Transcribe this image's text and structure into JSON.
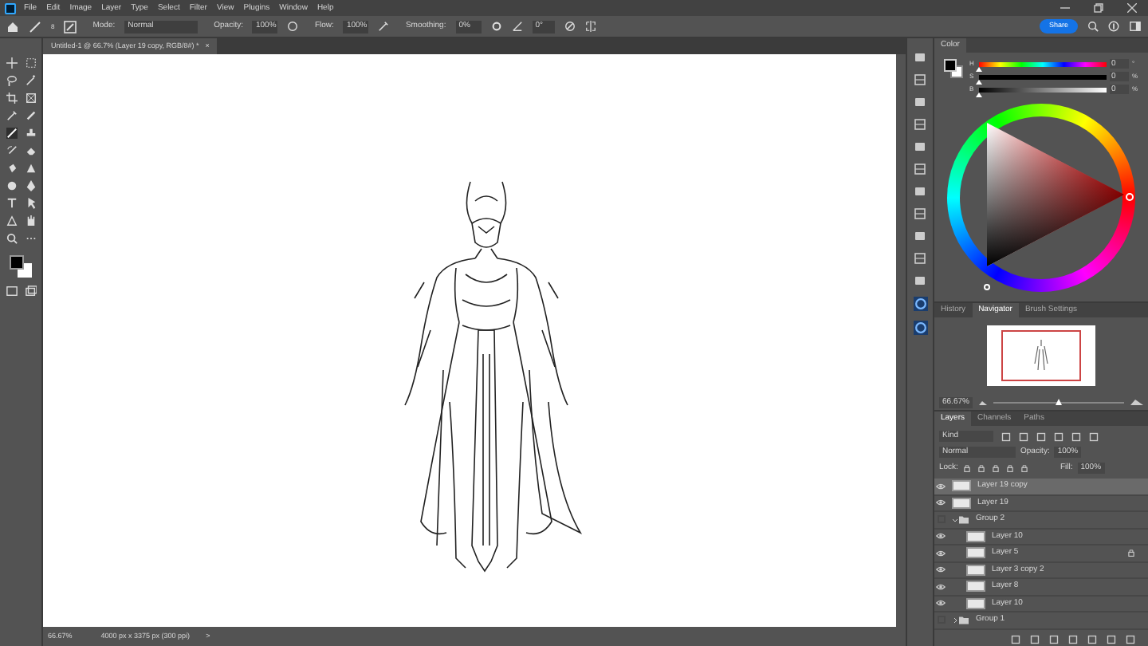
{
  "menu": [
    "File",
    "Edit",
    "Image",
    "Layer",
    "Type",
    "Select",
    "Filter",
    "View",
    "Plugins",
    "Window",
    "Help"
  ],
  "options_bar": {
    "brush_size": "8",
    "mode_label": "Mode:",
    "mode": "Normal",
    "opacity_label": "Opacity:",
    "opacity": "100%",
    "flow_label": "Flow:",
    "flow": "100%",
    "smoothing_label": "Smoothing:",
    "smoothing": "0%",
    "angle": "0°"
  },
  "share_button": "Share",
  "document_tab": {
    "title": "Untitled-1 @ 66.7% (Layer 19 copy, RGB/8#) *",
    "close": "×"
  },
  "color_panel": {
    "tab": "Color",
    "sliders": [
      {
        "label": "H",
        "value": "0",
        "unit": "°",
        "level": 0
      },
      {
        "label": "S",
        "value": "0",
        "unit": "%",
        "level": 0
      },
      {
        "label": "B",
        "value": "0",
        "unit": "%",
        "level": 0
      }
    ]
  },
  "navigator": {
    "tabs": [
      {
        "label": "History",
        "selected": false
      },
      {
        "label": "Navigator",
        "selected": true
      },
      {
        "label": "Brush Settings",
        "selected": false
      }
    ],
    "zoom": "66.67%",
    "level": 0.5
  },
  "layers_panel": {
    "tabs": [
      {
        "label": "Layers",
        "selected": true
      },
      {
        "label": "Channels",
        "selected": false
      },
      {
        "label": "Paths",
        "selected": false
      }
    ],
    "filter": "Kind",
    "blend_mode": "Normal",
    "opacity_label": "Opacity:",
    "opacity": "100%",
    "lock_label": "Lock:",
    "fill_label": "Fill:",
    "fill": "100%",
    "layers": [
      {
        "kind": "layer",
        "name": "Layer 19 copy",
        "visible": true,
        "selected": true,
        "locked": false
      },
      {
        "kind": "layer",
        "name": "Layer 19",
        "visible": true,
        "selected": false,
        "locked": false
      },
      {
        "kind": "group",
        "name": "Group 2",
        "visible": false,
        "selected": false,
        "expanded": true,
        "children": [
          {
            "kind": "layer",
            "name": "Layer 10",
            "visible": true,
            "selected": false,
            "locked": false
          },
          {
            "kind": "layer",
            "name": "Layer 5",
            "visible": true,
            "selected": false,
            "locked": true
          },
          {
            "kind": "layer",
            "name": "Layer 3 copy 2",
            "visible": true,
            "selected": false,
            "locked": false
          },
          {
            "kind": "layer",
            "name": "Layer 8",
            "visible": true,
            "selected": false,
            "locked": false
          },
          {
            "kind": "layer",
            "name": "Layer 10",
            "visible": true,
            "selected": false,
            "locked": false
          }
        ]
      },
      {
        "kind": "group",
        "name": "Group 1",
        "visible": false,
        "selected": false,
        "expanded": false
      }
    ]
  },
  "status_bar": {
    "zoom": "66.67%",
    "info": "4000 px x 3375 px (300 ppi)",
    "arrow": ">"
  }
}
